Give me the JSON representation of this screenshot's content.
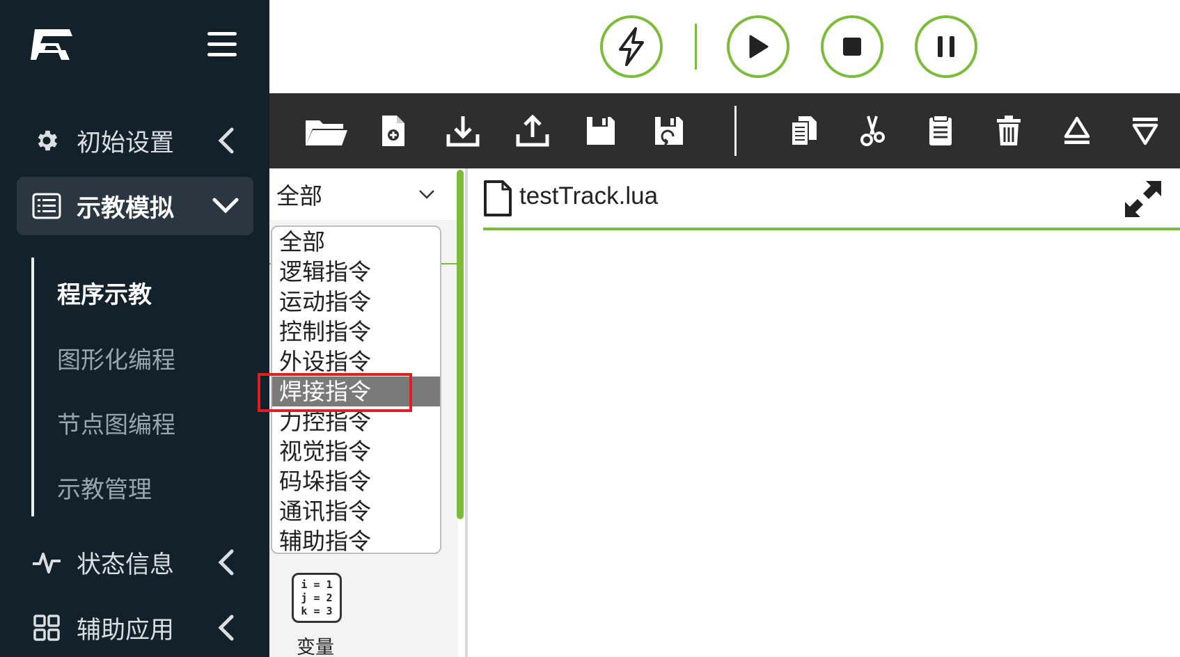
{
  "sidebar": {
    "logo": "robot-logo",
    "menu_icon": "hamburger-icon",
    "items": [
      {
        "label": "初始设置",
        "icon": "gear-icon"
      },
      {
        "label": "示教模拟",
        "icon": "list-icon"
      },
      {
        "label": "状态信息",
        "icon": "pulse-icon"
      },
      {
        "label": "辅助应用",
        "icon": "grid-icon"
      }
    ],
    "subitems": [
      {
        "label": "程序示教"
      },
      {
        "label": "图形化编程"
      },
      {
        "label": "节点图编程"
      },
      {
        "label": "示教管理"
      }
    ]
  },
  "controls": [
    "lightning-icon",
    "play-icon",
    "stop-icon",
    "pause-icon"
  ],
  "toolbar": [
    "open-folder-icon",
    "new-file-icon",
    "download-icon",
    "upload-icon",
    "save-icon",
    "save-as-icon",
    "copy-icon",
    "cut-icon",
    "paste-icon",
    "delete-icon",
    "move-up-icon",
    "move-down-icon"
  ],
  "panel": {
    "select_value": "全部",
    "options": [
      "全部",
      "逻辑指令",
      "运动指令",
      "控制指令",
      "外设指令",
      "焊接指令",
      "力控指令",
      "视觉指令",
      "码垛指令",
      "通讯指令",
      "辅助指令"
    ],
    "selected_index": 5,
    "variable": {
      "lines": [
        "i = 1",
        "j = 2",
        "k = 3"
      ],
      "label": "变量"
    }
  },
  "editor": {
    "file_name": "testTrack.lua"
  },
  "colors": {
    "sidebar": "#13212b",
    "accent": "#7dbb3a",
    "toolbar": "#2e2e2e",
    "highlight": "#e02020"
  }
}
